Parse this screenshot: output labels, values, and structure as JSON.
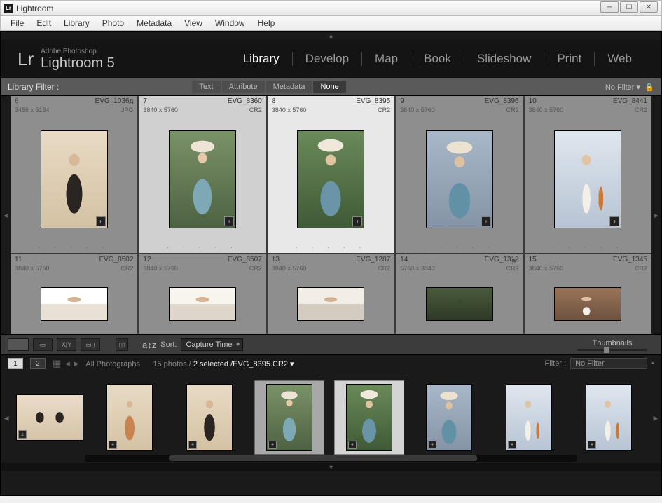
{
  "window": {
    "title": "Lightroom"
  },
  "menu": [
    "File",
    "Edit",
    "Library",
    "Photo",
    "Metadata",
    "View",
    "Window",
    "Help"
  ],
  "brand": {
    "small": "Adobe Photoshop",
    "big": "Lightroom 5",
    "logo": "Lr"
  },
  "modules": [
    "Library",
    "Develop",
    "Map",
    "Book",
    "Slideshow",
    "Print",
    "Web"
  ],
  "modules_active": "Library",
  "filterbar": {
    "label": "Library Filter :",
    "tabs": [
      "Text",
      "Attribute",
      "Metadata",
      "None"
    ],
    "active": "None",
    "nofilter": "No Filter"
  },
  "grid": [
    {
      "idx": "6",
      "name": "EVG_1036д",
      "dims": "3456 x 5184",
      "ext": "JPG",
      "cls": "p1"
    },
    {
      "idx": "7",
      "name": "EVG_8360",
      "dims": "3840 x 5760",
      "ext": "CR2",
      "cls": "p2",
      "sel": "sel2"
    },
    {
      "idx": "8",
      "name": "EVG_8395",
      "dims": "3840 x 5760",
      "ext": "CR2",
      "cls": "p3",
      "sel": "sel"
    },
    {
      "idx": "9",
      "name": "EVG_8396",
      "dims": "3840 x 5760",
      "ext": "CR2",
      "cls": "p4"
    },
    {
      "idx": "10",
      "name": "EVG_8441",
      "dims": "3840 x 5760",
      "ext": "CR2",
      "cls": "p5"
    },
    {
      "idx": "11",
      "name": "EVG_8502",
      "dims": "3840 x 5760",
      "ext": "CR2",
      "cls": "p6"
    },
    {
      "idx": "12",
      "name": "EVG_8507",
      "dims": "3840 x 5760",
      "ext": "CR2",
      "cls": "p7"
    },
    {
      "idx": "13",
      "name": "EVG_1287",
      "dims": "3840 x 5760",
      "ext": "CR2",
      "cls": "p8"
    },
    {
      "idx": "14",
      "name": "EVG_1312",
      "dims": "5760 x 3840",
      "ext": "CR2",
      "cls": "p9",
      "flag": true
    },
    {
      "idx": "15",
      "name": "EVG_1345",
      "dims": "3840 x 5760",
      "ext": "CR2",
      "cls": "p10"
    }
  ],
  "toolbar": {
    "sort_label": "Sort:",
    "sort_value": "Capture Time",
    "thumb_label": "Thumbnails"
  },
  "infobar": {
    "mon1": "1",
    "mon2": "2",
    "source": "All Photographs",
    "count": "15 photos /",
    "selected": "2 selected",
    "file": "/EVG_8395.CR2",
    "filter_label": "Filter :",
    "filter_value": "No Filter"
  },
  "filmstrip": [
    {
      "cls": "p0a",
      "wide": true
    },
    {
      "cls": "p0b"
    },
    {
      "cls": "p1"
    },
    {
      "cls": "p2",
      "sel": "sel2"
    },
    {
      "cls": "p3",
      "sel": "sel"
    },
    {
      "cls": "p4"
    },
    {
      "cls": "p5"
    },
    {
      "cls": "p5"
    }
  ]
}
